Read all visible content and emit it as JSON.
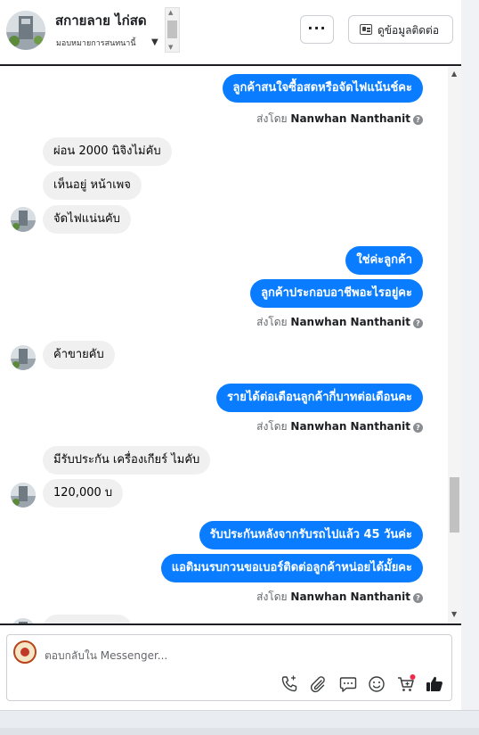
{
  "header": {
    "name": "สกายลาย ไก่สด",
    "assign_label": "มอบหมายการสนทนานี้",
    "more_label": "···",
    "contact_button_label": "ดูข้อมูลติดต่อ"
  },
  "messages": {
    "out1": "ลูกค้าสนใจซื้อสดหรือจัดไฟแน้นช์คะ",
    "in1": "ผ่อน 2000 นิจิงไม่คับ",
    "in2": "เห็นอยู่ หน้าเพจ",
    "in3": "จัดไฟแน่นคับ",
    "out2": "ใช่ค่ะลูกค้า",
    "out3": "ลูกค้าประกอบอาชีพอะไรอยู่คะ",
    "in4": "ค้าขายคับ",
    "out4": "รายได้ต่อเดือนลูกค้ากี่บาทต่อเดือนคะ",
    "in5": "มีรับประกัน เครื่องเกียร์ ไมคับ",
    "in6": "120,000 บ",
    "out5": "รับประกันหลังจากรับรถไปแล้ว 45 วันค่ะ",
    "out6": "แอดิมนรบกวนขอเบอร์ติดต่อลูกค้าหน่อยได้มั้ยคะ"
  },
  "sent_by": {
    "prefix": "ส่งโดย",
    "name": "Nanwhan Nanthanit",
    "help": "?"
  },
  "composer": {
    "placeholder": "ตอบกลับใน Messenger..."
  },
  "icons": [
    "call-icon",
    "attachment-icon",
    "saved-reply-icon",
    "emoji-icon",
    "cart-icon",
    "like-icon"
  ],
  "colors": {
    "outgoing_bubble": "#0a7cff",
    "incoming_bubble": "#f0f0f0",
    "notification_dot": "#f02849"
  }
}
